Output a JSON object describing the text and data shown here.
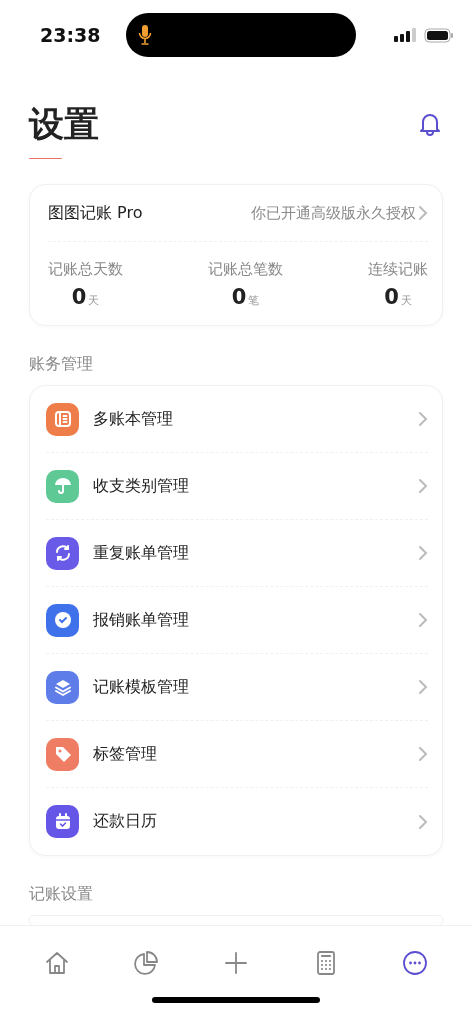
{
  "status_bar": {
    "time": "23:38",
    "mic_active": true
  },
  "header": {
    "title": "设置"
  },
  "pro_card": {
    "name": "图图记账 Pro",
    "status": "你已开通高级版永久授权",
    "stats": [
      {
        "label": "记账总天数",
        "value": "0",
        "unit": "天"
      },
      {
        "label": "记账总笔数",
        "value": "0",
        "unit": "笔"
      },
      {
        "label": "连续记账",
        "value": "0",
        "unit": "天"
      }
    ]
  },
  "sections": [
    {
      "title": "账务管理",
      "items": [
        {
          "label": "多账本管理",
          "kind": "book",
          "color": "#ee7d4a"
        },
        {
          "label": "收支类别管理",
          "kind": "umbrella",
          "color": "#5fc995"
        },
        {
          "label": "重复账单管理",
          "kind": "repeat",
          "color": "#6a5ae8"
        },
        {
          "label": "报销账单管理",
          "kind": "badge",
          "color": "#3f72ea"
        },
        {
          "label": "记账模板管理",
          "kind": "layers",
          "color": "#5f7de8"
        },
        {
          "label": "标签管理",
          "kind": "tag",
          "color": "#ef7d63"
        },
        {
          "label": "还款日历",
          "kind": "calendar",
          "color": "#6656e8"
        }
      ]
    },
    {
      "title": "记账设置"
    }
  ],
  "tab_bar": [
    {
      "kind": "home",
      "selected": false
    },
    {
      "kind": "chart",
      "selected": false
    },
    {
      "kind": "plus",
      "selected": false
    },
    {
      "kind": "calculator",
      "selected": false
    },
    {
      "kind": "more",
      "selected": true
    }
  ]
}
